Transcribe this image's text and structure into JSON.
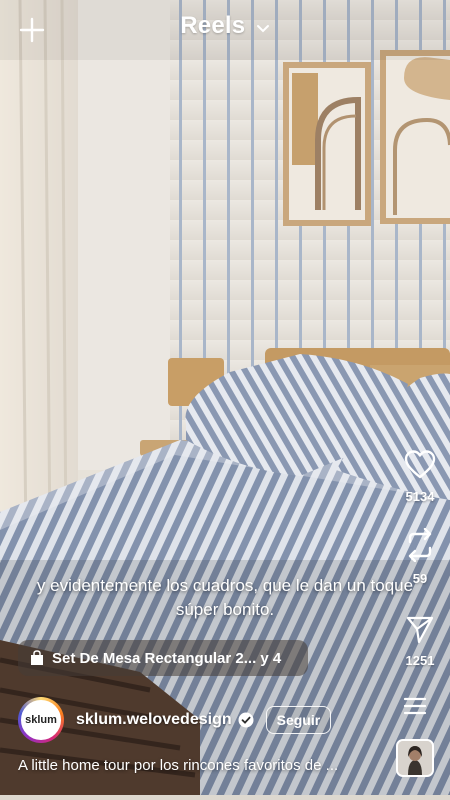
{
  "header": {
    "title": "Reels"
  },
  "actions": {
    "likes": "5134",
    "remixes": "59",
    "shares": "1251"
  },
  "subtitle": {
    "text": "y evidentemente los cuadros, que le dan un toque súper bonito."
  },
  "product": {
    "label": "Set De Mesa Rectangular 2... y 4"
  },
  "account": {
    "avatar_text": "sklum",
    "handle": "sklum.welovedesign",
    "follow_label": "Seguir"
  },
  "caption": {
    "text": "A little home tour por los rincones favoritos de ..."
  },
  "icons": {
    "plus": "plus-icon",
    "chevron": "chevron-down-icon",
    "like": "heart-icon",
    "remix": "repeat-icon",
    "share": "send-icon",
    "menu": "menu-icon",
    "shop": "shopping-bag-icon",
    "verified": "verified-badge-icon"
  },
  "colors": {
    "text": "#ffffff",
    "chip_bg": "#463c37"
  }
}
